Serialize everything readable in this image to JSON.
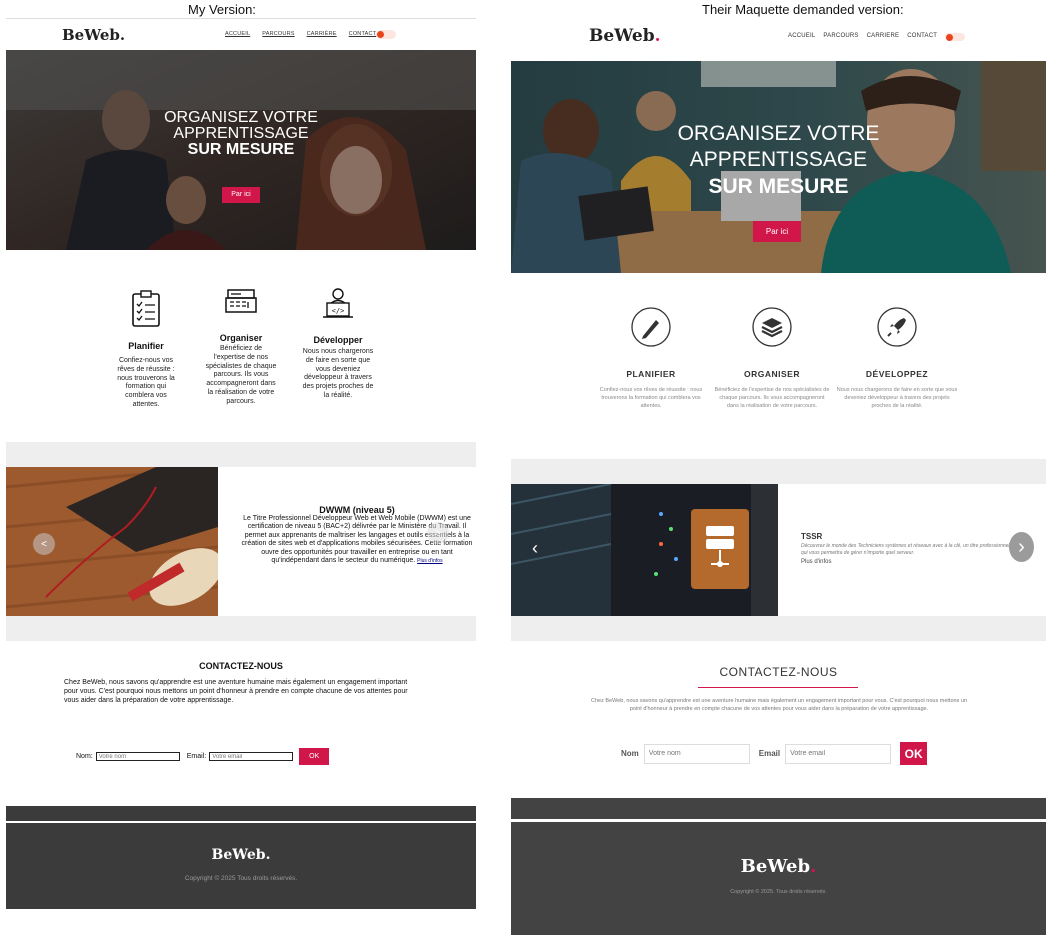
{
  "captions": {
    "left": "My Version:",
    "right": "Their Maquette demanded version:"
  },
  "left": {
    "logo": "BeWeb",
    "logo_dot": ".",
    "nav": [
      "ACCUEIL",
      "PARCOURS",
      "CARRIÈRE",
      "CONTACT"
    ],
    "hero": {
      "line1": "ORGANISEZ VOTRE",
      "line2": "APPRENTISSAGE",
      "line3": "SUR MESURE",
      "button": "Par ici"
    },
    "features": [
      {
        "title": "Planifier",
        "text": "Confiez-nous vos rêves de réussite : nous trouverons la formation qui comblera vos attentes.",
        "icon": "clipboard-checklist-icon"
      },
      {
        "title": "Organiser",
        "text": "Bénéficiez de l'expertise de nos spécialistes de chaque parcours. Ils vous accompagneront dans la réalisation de votre parcours.",
        "icon": "cash-register-icon"
      },
      {
        "title": "Développer",
        "text": "Nous nous chargerons de faire en sorte que vous deveniez développeur à travers des projets proches de la réalité.",
        "icon": "developer-laptop-icon"
      }
    ],
    "carousel": {
      "title": "DWWM (niveau 5)",
      "text": "Le Titre Professionnel Développeur Web et Web Mobile (DWWM) est une certification de niveau 5 (BAC+2) délivrée par le Ministère du Travail. Il permet aux apprenants de maîtriser les langages et outils essentiels à la création de sites web et d'applications mobiles sécurisées. Cette formation ouvre des opportunités pour travailler en entreprise ou en tant qu'indépendant dans le secteur du numérique.",
      "link": "Plus d'infos",
      "prev": "<",
      "next": ">"
    },
    "contact": {
      "title": "CONTACTEZ-NOUS",
      "text": "Chez BeWeb, nous savons qu'apprendre est une aventure humaine mais également un engagement important pour vous. C'est pourquoi nous mettons un point d'honneur à prendre en compte chacune de vos attentes pour vous aider dans la préparation de votre apprentissage.",
      "name_label": "Nom:",
      "name_placeholder": "Votre nom",
      "email_label": "Email:",
      "email_placeholder": "Votre email",
      "submit": "OK"
    },
    "footer": {
      "logo": "BeWeb.",
      "copyright": "Copyright © 2025 Tous droits réservés."
    }
  },
  "right": {
    "logo": "BeWeb",
    "logo_dot": ".",
    "nav": [
      "ACCUEIL",
      "PARCOURS",
      "CARRIERE",
      "CONTACT"
    ],
    "hero": {
      "line1": "ORGANISEZ VOTRE",
      "line2": "APPRENTISSAGE",
      "line3": "SUR MESURE",
      "button": "Par ici"
    },
    "features": [
      {
        "title": "PLANIFIER",
        "text": "Confiez-nous vos rêves de réussite : nous trouverons la formation qui comblera vos attentes.",
        "icon": "pen-circle-icon"
      },
      {
        "title": "ORGANISER",
        "text": "Bénéficiez de l'expertise de nos spécialistes de chaque parcours. Ils vous accompagneront dans la réalisation de votre parcours.",
        "icon": "layers-circle-icon"
      },
      {
        "title": "DÉVELOPPEZ",
        "text": "Nous nous chargerons de faire en sorte que vous deveniez développeur à travers des projets proches de la réalité.",
        "icon": "rocket-circle-icon"
      }
    ],
    "carousel": {
      "title": "TSSR",
      "text": "Découvrez le monde des Techniciens systèmes et réseaux avec à la clé, un titre professionnel niveau 5 qui vous permettra de gérer n'importe quel serveur.",
      "link": "Plus d'infos",
      "prev": "‹",
      "next": "›"
    },
    "contact": {
      "title": "CONTACTEZ-NOUS",
      "text": "Chez BeWeb, nous savons qu'apprendre est une aventure humaine mais également un engagement important pour vous. C'est pourquoi nous mettons un point d'honneur à prendre en compte chacune de vos attentes pour vous aider dans la préparation de votre apprentissage.",
      "name_label": "Nom",
      "name_placeholder": "Votre nom",
      "email_label": "Email",
      "email_placeholder": "Votre email",
      "submit": "OK"
    },
    "footer": {
      "logo": "BeWeb",
      "logo_dot": ".",
      "copyright": "Copyright © 2025. Tous droits réservés."
    }
  },
  "colors": {
    "accent": "#d1174a",
    "toggle": "#e8431a",
    "footer": "#3b3b3b",
    "band": "#eeeeee"
  }
}
